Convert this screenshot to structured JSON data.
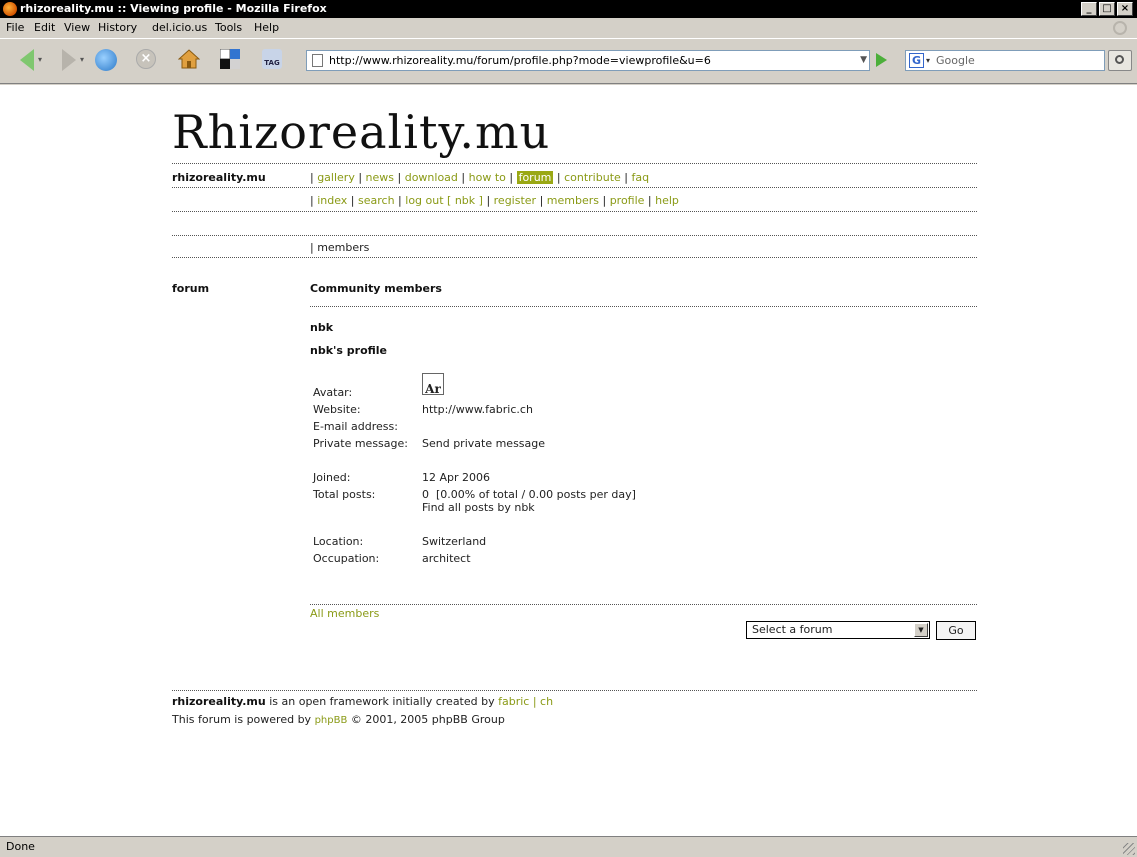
{
  "window": {
    "title": "rhizoreality.mu :: Viewing profile - Mozilla Firefox"
  },
  "menu": [
    "File",
    "Edit",
    "View",
    "History",
    "del.icio.us",
    "Tools",
    "Help"
  ],
  "toolbar": {
    "url": "http://www.rhizoreality.mu/forum/profile.php?mode=viewprofile&u=6",
    "search_placeholder": "Google",
    "tag_label": "TAG"
  },
  "site": {
    "title": "Rhizoreality.mu",
    "brand": "rhizoreality.mu",
    "primary_nav": [
      "gallery",
      "news",
      "download",
      "how to",
      "forum",
      "contribute",
      "faq"
    ],
    "secondary_nav": [
      "index",
      "search",
      "log out [ nbk ]",
      "register",
      "members",
      "profile",
      "help"
    ],
    "breadcrumb": "members",
    "section": "forum",
    "heading": "Community members"
  },
  "profile": {
    "username": "nbk",
    "profile_title": "nbk's profile",
    "avatar_label": "Avatar:",
    "avatar_text": "Ar",
    "website_label": "Website:",
    "website": "http://www.fabric.ch",
    "email_label": "E-mail address:",
    "pm_label": "Private message:",
    "pm_link": "Send private message",
    "joined_label": "Joined:",
    "joined": "12 Apr 2006",
    "posts_label": "Total posts:",
    "posts": "0  [0.00% of total / 0.00 posts per day]",
    "find_posts": "Find all posts by nbk",
    "location_label": "Location:",
    "location": "Switzerland",
    "occupation_label": "Occupation:",
    "occupation": "architect"
  },
  "footer_nav": {
    "all_members": "All members",
    "select_forum": "Select a forum",
    "go": "Go"
  },
  "footer": {
    "brand": "rhizoreality.mu",
    "line1_text": " is an open framework initially created by ",
    "line1_link": "fabric | ch",
    "line2_text": "This forum is powered by ",
    "line2_link": "phpBB",
    "line2_rest": " © 2001, 2005 phpBB Group"
  },
  "status": "Done",
  "colors": {
    "link": "#8a9a16",
    "highlight": "#9aa814"
  }
}
